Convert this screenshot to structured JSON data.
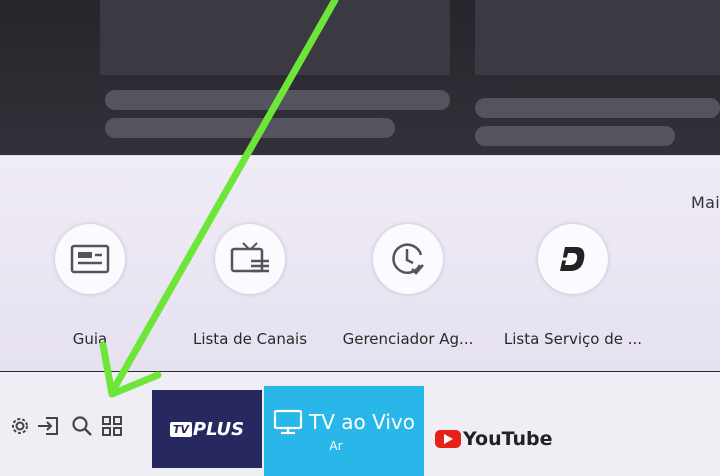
{
  "more_label": "Mai",
  "quick_items": [
    {
      "label": "Guia",
      "icon": "guide-icon"
    },
    {
      "label": "Lista de Canais",
      "icon": "channel-list-icon"
    },
    {
      "label": "Gerenciador Ag...",
      "icon": "clock-check-icon"
    },
    {
      "label": "Lista Serviço de ...",
      "icon": "service-d-icon"
    }
  ],
  "bottom_icons": [
    "settings-icon",
    "source-icon",
    "search-icon",
    "apps-icon"
  ],
  "apps": {
    "tvplus": {
      "badge": "TV",
      "label": "PLUS"
    },
    "live": {
      "label": "TV ao Vivo",
      "sub": "Ar"
    },
    "youtube": {
      "label": "YouTube"
    }
  },
  "colors": {
    "arrow": "#6ee639",
    "live_tile": "#29b6e9",
    "tvplus_tile": "#272860",
    "youtube_red": "#e62117"
  }
}
